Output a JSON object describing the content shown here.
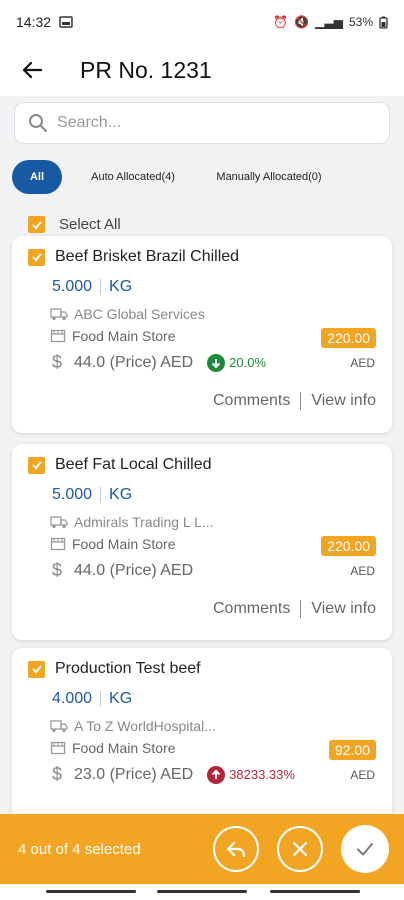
{
  "status": {
    "time": "14:32",
    "battery": "53%"
  },
  "header": {
    "title": "PR No. 1231"
  },
  "search": {
    "placeholder": "Search..."
  },
  "tabs": [
    {
      "label": "All"
    },
    {
      "label": "Auto Allocated(4)"
    },
    {
      "label": "Manually Allocated(0)"
    }
  ],
  "select_all_label": "Select All",
  "cards": [
    {
      "title": "Beef Brisket Brazil Chilled",
      "qty": "5.000",
      "unit": "KG",
      "supplier": "ABC Global Services",
      "store": "Food Main Store",
      "price": "44.0 (Price) AED",
      "pct": "20.0%",
      "amount": "220.00",
      "currency": "AED",
      "comments": "Comments",
      "view": "View info"
    },
    {
      "title": "Beef Fat Local Chilled",
      "qty": "5.000",
      "unit": "KG",
      "supplier": "Admirals Trading L L...",
      "store": "Food Main Store",
      "price": "44.0 (Price) AED",
      "amount": "220.00",
      "currency": "AED",
      "comments": "Comments",
      "view": "View info"
    },
    {
      "title": "Production Test beef",
      "qty": "4.000",
      "unit": "KG",
      "supplier": "A To Z WorldHospital...",
      "store": "Food Main Store",
      "price": "23.0 (Price) AED",
      "pct": "38233.33%",
      "amount": "92.00",
      "currency": "AED"
    }
  ],
  "bottom": {
    "selected_text": "4 out of 4 selected"
  },
  "colors": {
    "accent": "#f2a522",
    "primary": "#175aa3",
    "down": "#1b8a3a",
    "up": "#b3283c"
  },
  "icons": [
    "back-arrow-icon",
    "search-icon",
    "check-icon",
    "truck-icon",
    "store-icon",
    "dollar-icon",
    "arrow-down-icon",
    "arrow-up-icon",
    "reply-icon",
    "close-icon"
  ]
}
